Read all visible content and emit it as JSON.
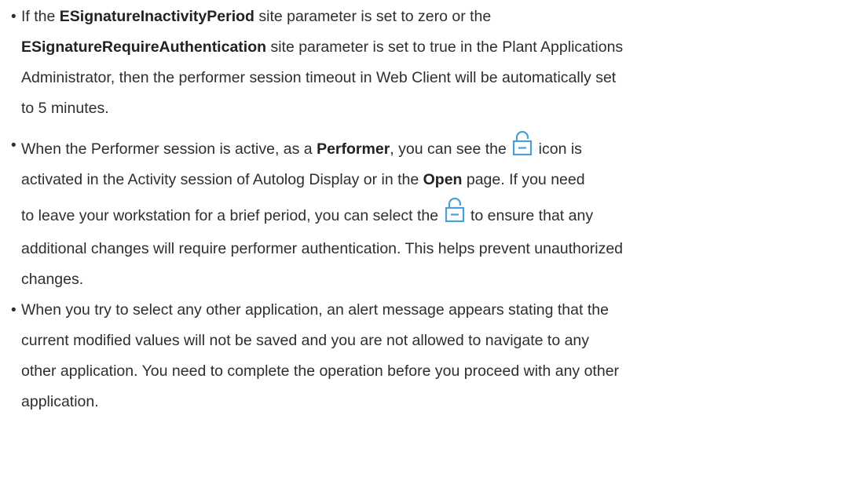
{
  "bullets": [
    {
      "lines": [
        [
          "If the ",
          "ESignatureInactivityPeriod",
          " site parameter is set to zero or the"
        ],
        [
          "ESignatureRequireAuthentication",
          " site parameter is set to true in the Plant Applications"
        ],
        [
          "Administrator, then the performer session timeout in Web Client will be automatically set"
        ],
        [
          "to 5 minutes."
        ]
      ]
    },
    {
      "line1_pre": "When the Performer session is active, as a ",
      "line1_bold": "Performer",
      "line1_mid": ", you can see the ",
      "line1_post": " icon is",
      "line2_pre": "activated in the Activity session of Autolog Display or in the ",
      "line2_bold": "Open",
      "line2_post": " page. If you need",
      "line3_pre": "to leave your workstation for a brief period, you can select the ",
      "line3_post": " to ensure that any",
      "line4": "additional changes will require performer authentication. This helps prevent unauthorized",
      "line5": "changes."
    },
    {
      "line1": "When you try to select any other application, an alert message appears stating that the",
      "line2": "current modified values will not be saved and you are not allowed to navigate to any",
      "line3": "other application. You need to complete the operation before you proceed with any other",
      "line4": "application."
    }
  ],
  "bullet_glyph": "•",
  "icons": {
    "lock": "unlock-icon",
    "lock_color": "#4a9fd8"
  }
}
